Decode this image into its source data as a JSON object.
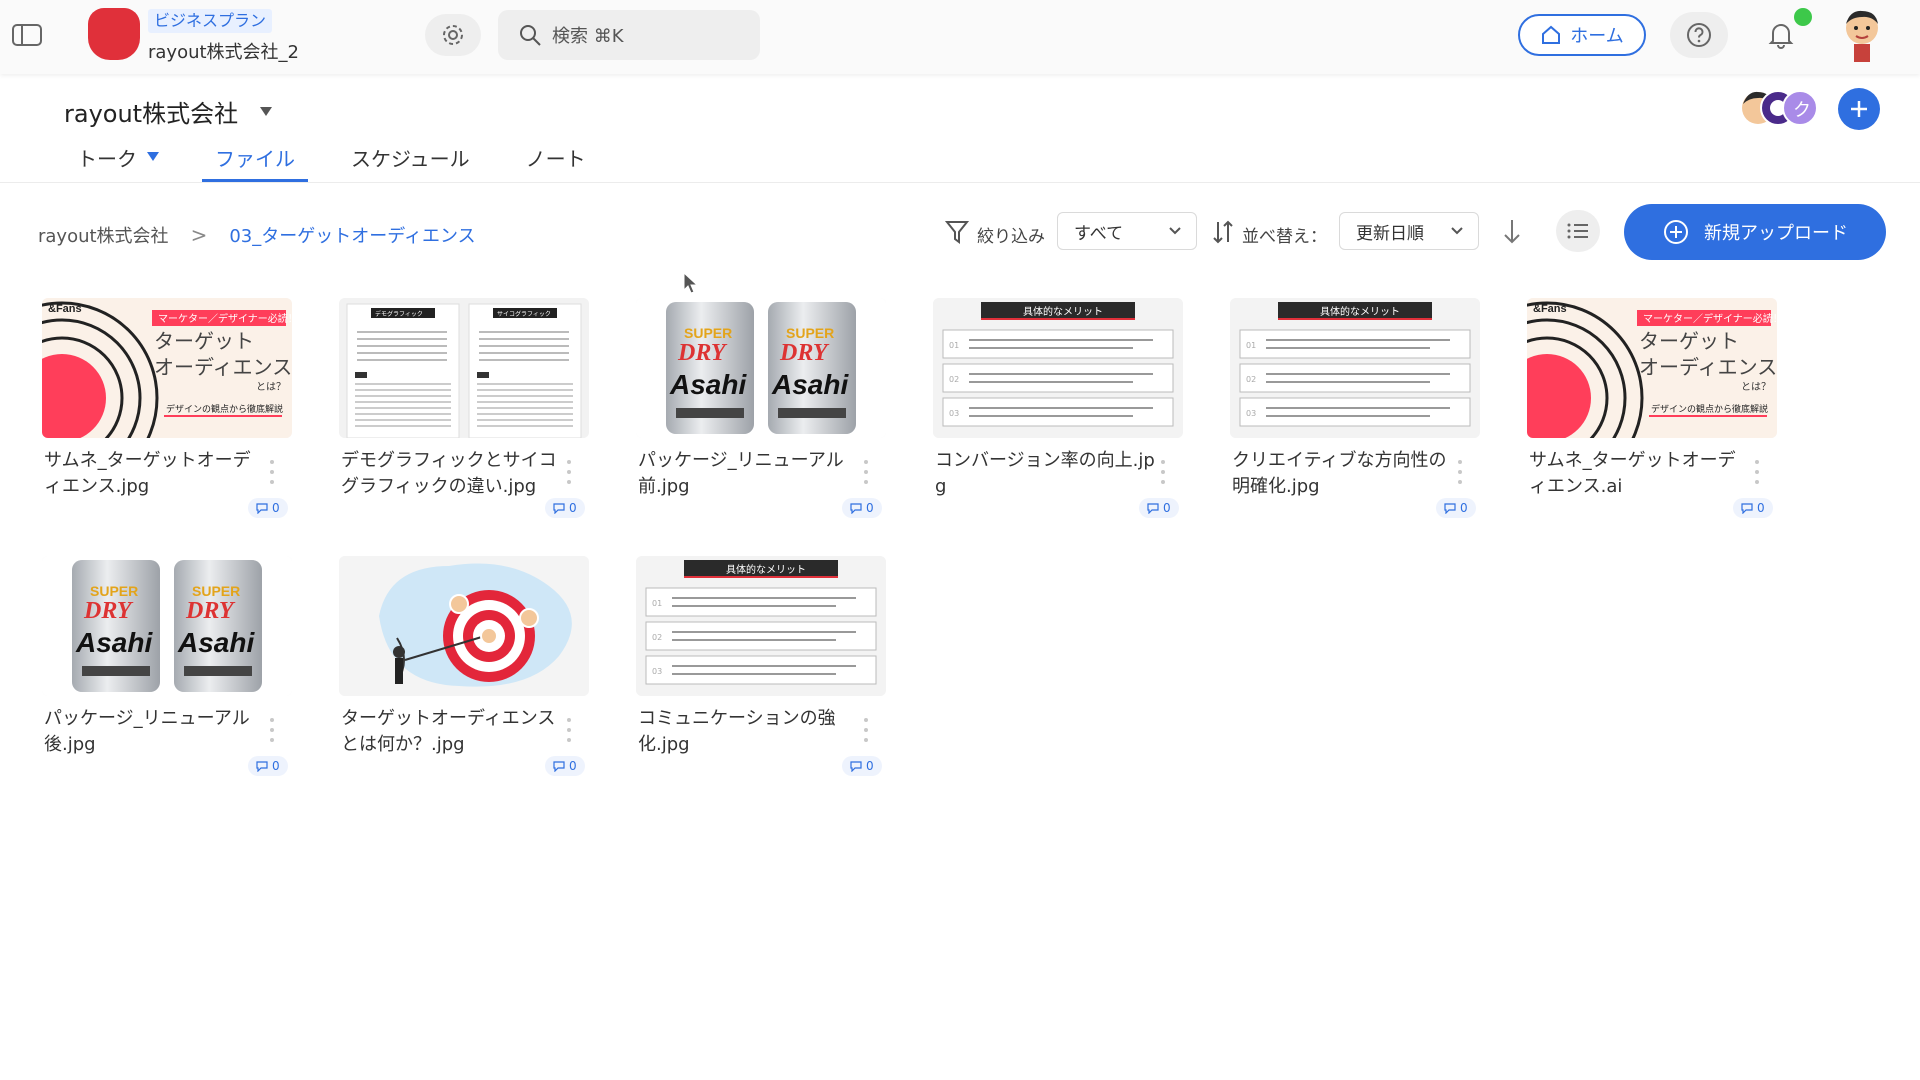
{
  "header": {
    "plan": "ビジネスプラン",
    "company_sub": "rayout株式会社_2",
    "search_placeholder": "検索 ⌘K",
    "home_label": "ホーム"
  },
  "workspace": {
    "title": "rayout株式会社",
    "member_initial": "ク"
  },
  "tabs": [
    {
      "label": "トーク"
    },
    {
      "label": "ファイル",
      "active": true
    },
    {
      "label": "スケジュール"
    },
    {
      "label": "ノート"
    }
  ],
  "breadcrumb": {
    "root": "rayout株式会社",
    "separator": ">",
    "current": "03_ターゲットオーディエンス"
  },
  "toolbar": {
    "filter_label": "絞り込み",
    "filter_value": "すべて",
    "sort_label": "並べ替え：",
    "sort_value": "更新日順",
    "upload_label": "新規アップロード"
  },
  "files": [
    {
      "name": "サムネ_ターゲットオーディエンス.jpg",
      "comments": "0",
      "thumb": "banner"
    },
    {
      "name": "デモグラフィックとサイコグラフィックの違い.jpg",
      "comments": "0",
      "thumb": "docs"
    },
    {
      "name": "パッケージ_リニューアル前.jpg",
      "comments": "0",
      "thumb": "cans"
    },
    {
      "name": "コンバージョン率の向上.jpg",
      "comments": "0",
      "thumb": "merits"
    },
    {
      "name": "クリエイティブな方向性の明確化.jpg",
      "comments": "0",
      "thumb": "merits"
    },
    {
      "name": "サムネ_ターゲットオーディエンス.ai",
      "comments": "0",
      "thumb": "banner"
    },
    {
      "name": "パッケージ_リニューアル後.jpg",
      "comments": "0",
      "thumb": "cans"
    },
    {
      "name": "ターゲットオーディエンスとは何か？.jpg",
      "comments": "0",
      "thumb": "target"
    },
    {
      "name": "コミュニケーションの強化.jpg",
      "comments": "0",
      "thumb": "merits"
    }
  ],
  "thumb_text": {
    "banner": {
      "brand": "&Fans",
      "tag": "マーケター／デザイナー必読！",
      "line1": "ターゲット",
      "line2": "オーディエンス",
      "line3": "とは？",
      "foot": "デザインの観点から徹底解説"
    },
    "docs": {
      "left_title": "デモグラフィック",
      "right_title": "サイコグラフィック"
    },
    "cans": {
      "brand": "Asahi",
      "dry": "DRY",
      "super": "SUPER"
    },
    "merits": {
      "title": "具体的なメリット",
      "nums": [
        "01",
        "02",
        "03"
      ]
    }
  },
  "colors": {
    "accent": "#2f6fe0",
    "logo": "#e0303a",
    "notification": "#3dc84a"
  }
}
